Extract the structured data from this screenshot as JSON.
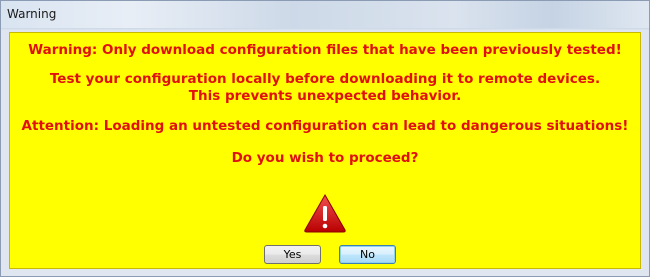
{
  "window": {
    "title": "Warning"
  },
  "dialog": {
    "line1": "Warning: Only download configuration files that have been previously tested!",
    "line2a": "Test your configuration locally before downloading it to remote devices.",
    "line2b": "This prevents unexpected behavior.",
    "line3": "Attention: Loading an untested configuration can lead to dangerous situations!",
    "question": "Do you wish to proceed?",
    "icon": "warning-triangle-icon",
    "background_color": "#ffff00",
    "text_color": "#e01010"
  },
  "buttons": {
    "yes_label": "Yes",
    "no_label": "No"
  }
}
